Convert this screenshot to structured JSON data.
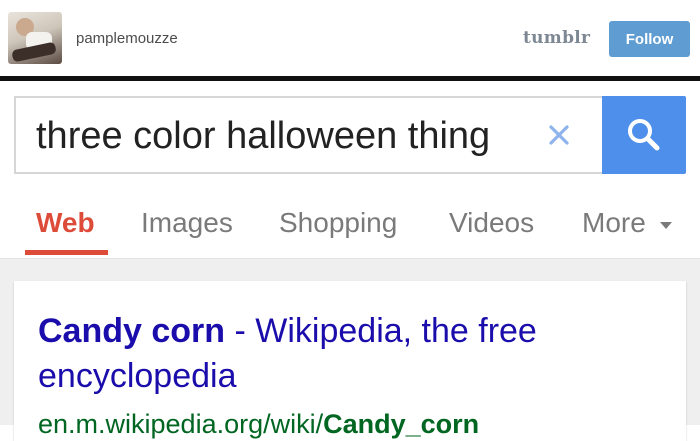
{
  "tumblr": {
    "blog_name": "pamplemouzze",
    "logo": "tumblr",
    "follow_label": "Follow",
    "accent": "#5f9cd1"
  },
  "search": {
    "query": "three color halloween thing",
    "clear_icon": "close-icon",
    "search_icon": "magnifier-icon",
    "button_color": "#4d8fea"
  },
  "tabs": [
    {
      "label": "Web",
      "active": true
    },
    {
      "label": "Images",
      "active": false
    },
    {
      "label": "Shopping",
      "active": false
    },
    {
      "label": "Videos",
      "active": false
    },
    {
      "label": "More",
      "active": false
    }
  ],
  "result": {
    "title_bold": "Candy corn",
    "title_rest": " - Wikipedia, the free encyclopedia",
    "url_plain": "en.m.wikipedia.org/wiki/",
    "url_bold": "Candy_corn",
    "title_color": "#1a0dab",
    "url_color": "#006621"
  }
}
